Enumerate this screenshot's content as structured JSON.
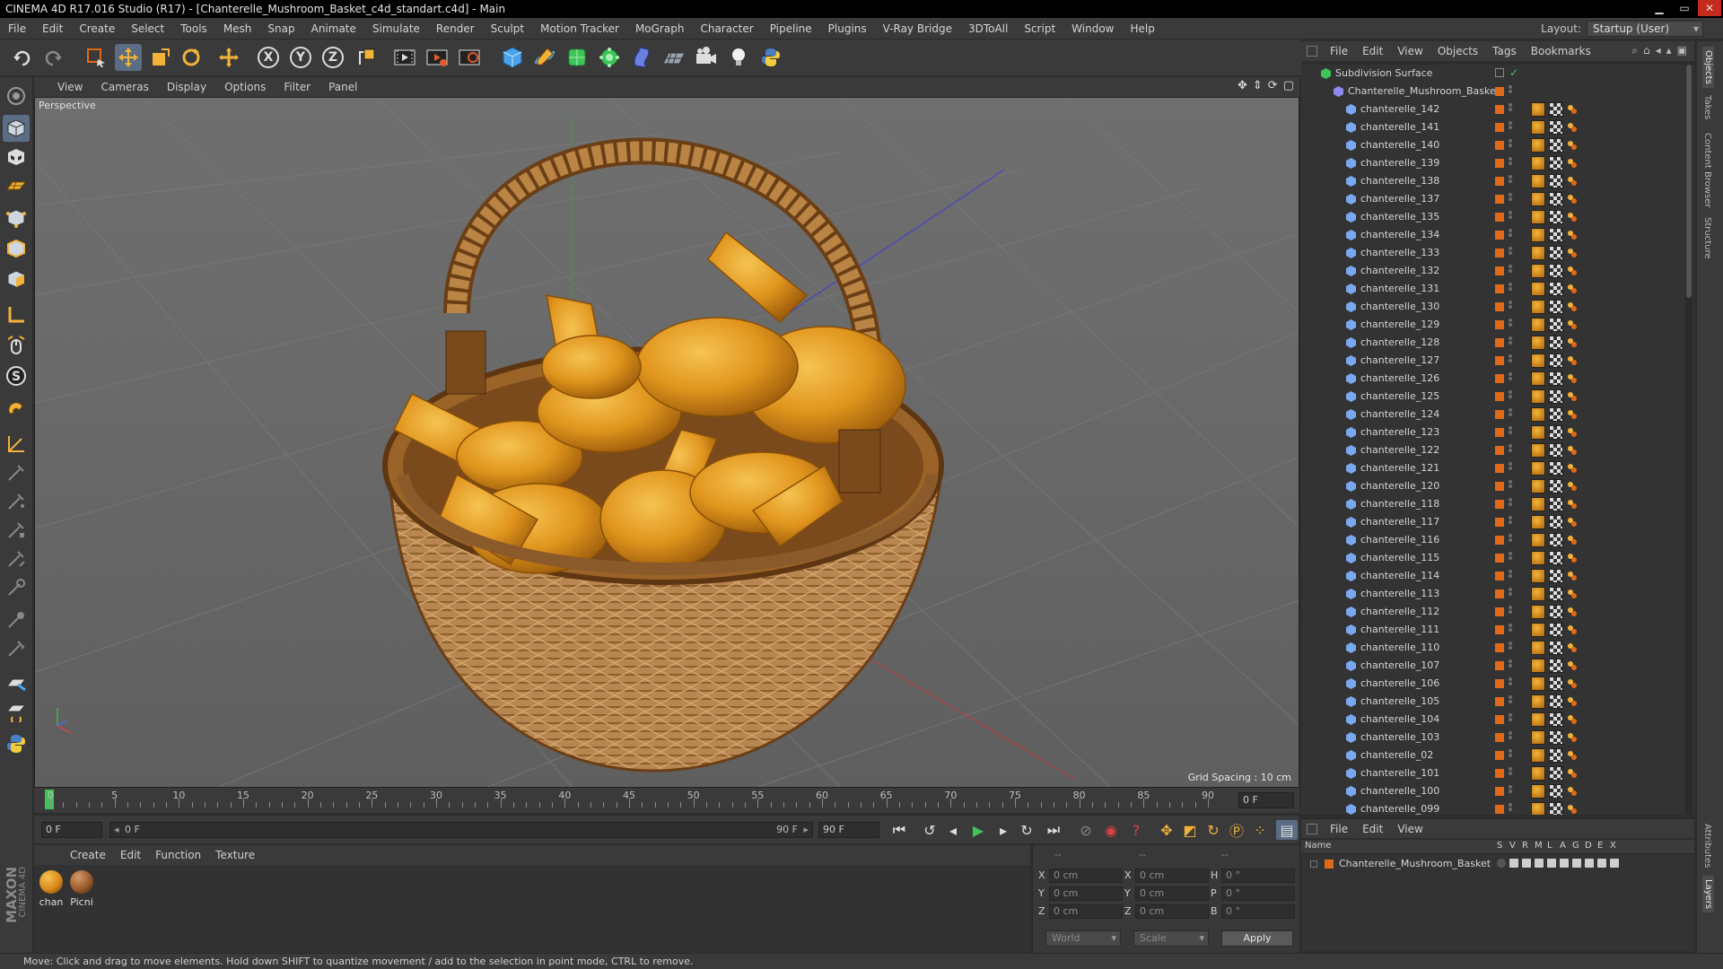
{
  "window": {
    "title": "CINEMA 4D R17.016 Studio (R17) - [Chanterelle_Mushroom_Basket_c4d_standart.c4d] - Main"
  },
  "menubar": {
    "items": [
      "File",
      "Edit",
      "Create",
      "Select",
      "Tools",
      "Mesh",
      "Snap",
      "Animate",
      "Simulate",
      "Render",
      "Sculpt",
      "Motion Tracker",
      "MoGraph",
      "Character",
      "Pipeline",
      "Plugins",
      "V-Ray Bridge",
      "3DToAll",
      "Script",
      "Window",
      "Help"
    ],
    "layout_label": "Layout:",
    "layout_value": "Startup (User)"
  },
  "toolbar": {
    "icons": [
      "undo-icon",
      "redo-icon",
      "live-selection-icon",
      "move-icon",
      "scale-icon",
      "rotate-icon",
      "recent-tool-icon",
      "x-axis-icon",
      "y-axis-icon",
      "z-axis-icon",
      "world-coordinates-icon",
      "render-view-icon",
      "render-picture-viewer-icon",
      "edit-render-settings-icon",
      "cube-icon",
      "pen-icon",
      "subdivision-icon",
      "mograph-cloner-icon",
      "deformer-icon",
      "floor-icon",
      "camera-icon",
      "light-icon",
      "python-icon"
    ],
    "axis_labels": [
      "X",
      "Y",
      "Z"
    ]
  },
  "viewport": {
    "menu": [
      "View",
      "Cameras",
      "Display",
      "Options",
      "Filter",
      "Panel"
    ],
    "camera_label": "Perspective",
    "grid_spacing": "Grid Spacing : 10 cm"
  },
  "timeline": {
    "ticks": [
      "0",
      "5",
      "10",
      "15",
      "20",
      "25",
      "30",
      "35",
      "40",
      "45",
      "50",
      "55",
      "60",
      "65",
      "70",
      "75",
      "80",
      "85",
      "90"
    ],
    "current_frame": "0 F"
  },
  "transport": {
    "start_field": "0 F",
    "range_start": "0 F",
    "range_end": "90 F",
    "end_field": "90 F"
  },
  "material_manager": {
    "menu": [
      "Create",
      "Edit",
      "Function",
      "Texture"
    ],
    "materials": [
      {
        "label": "chan",
        "color": "#d98a1c"
      },
      {
        "label": "Picni",
        "color": "#9a5a2c"
      }
    ]
  },
  "coordinates": {
    "header": [
      "--",
      "--",
      "--"
    ],
    "rows": [
      {
        "a": "X",
        "av": "0 cm",
        "b": "X",
        "bv": "0 cm",
        "c": "H",
        "cv": "0 °"
      },
      {
        "a": "Y",
        "av": "0 cm",
        "b": "Y",
        "bv": "0 cm",
        "c": "P",
        "cv": "0 °"
      },
      {
        "a": "Z",
        "av": "0 cm",
        "b": "Z",
        "bv": "0 cm",
        "c": "B",
        "cv": "0 °"
      }
    ],
    "mode": "World",
    "type": "Scale",
    "apply": "Apply"
  },
  "status": "Move: Click and drag to move elements. Hold down SHIFT to quantize movement / add to the selection in point mode, CTRL to remove.",
  "object_manager": {
    "menu": [
      "File",
      "Edit",
      "View",
      "Objects",
      "Tags",
      "Bookmarks"
    ],
    "root": "Subdivision Surface",
    "group": "Chanterelle_Mushroom_Basket",
    "objects": [
      "chanterelle_142",
      "chanterelle_141",
      "chanterelle_140",
      "chanterelle_139",
      "chanterelle_138",
      "chanterelle_137",
      "chanterelle_135",
      "chanterelle_134",
      "chanterelle_133",
      "chanterelle_132",
      "chanterelle_131",
      "chanterelle_130",
      "chanterelle_129",
      "chanterelle_128",
      "chanterelle_127",
      "chanterelle_126",
      "chanterelle_125",
      "chanterelle_124",
      "chanterelle_123",
      "chanterelle_122",
      "chanterelle_121",
      "chanterelle_120",
      "chanterelle_118",
      "chanterelle_117",
      "chanterelle_116",
      "chanterelle_115",
      "chanterelle_114",
      "chanterelle_113",
      "chanterelle_112",
      "chanterelle_111",
      "chanterelle_110",
      "chanterelle_107",
      "chanterelle_106",
      "chanterelle_105",
      "chanterelle_104",
      "chanterelle_103",
      "chanterelle_02",
      "chanterelle_101",
      "chanterelle_100",
      "chanterelle_099"
    ]
  },
  "layer_manager": {
    "menu": [
      "File",
      "Edit",
      "View"
    ],
    "columns": [
      "Name",
      "S",
      "V",
      "R",
      "M",
      "L",
      "A",
      "G",
      "D",
      "E",
      "X"
    ],
    "layers": [
      "Chanterelle_Mushroom_Basket"
    ]
  },
  "side_tabs": [
    "Objects",
    "Takes",
    "Content Browser",
    "Structure",
    "Attributes",
    "Layers"
  ],
  "logo": {
    "line1": "MAXON",
    "line2": "CINEMA 4D"
  },
  "colors": {
    "layer": "#e06a18",
    "accent": "#5b6d84",
    "mushroom": "#e0981f",
    "wicker": "#b07a3c"
  }
}
